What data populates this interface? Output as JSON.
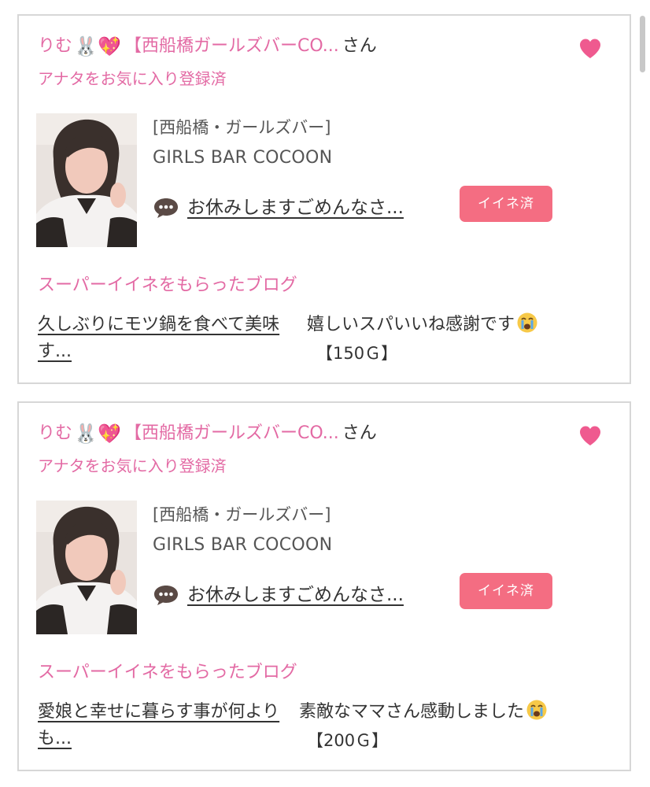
{
  "colors": {
    "accent_pink": "#e36aa4",
    "badge_pink": "#f46d82",
    "heart_pink": "#ef5a8f",
    "border_gray": "#d7d7d7"
  },
  "cards": [
    {
      "cast_name": "りむ",
      "emoji_1": "🐰",
      "emoji_2": "💖",
      "shop_short": "【西船橋ガールズバーCO...",
      "honorific": "さん",
      "favorite_status": "アナタをお気に入り登録済",
      "like_icon": "heart-icon",
      "shop_category": "[西船橋・ガールズバー]",
      "shop_name": "GIRLS BAR COCOON",
      "chat_icon": "speech-bubble-icon",
      "post_title": "お休みしますごめんなさ...",
      "iine_label": "イイネ済",
      "super_label": "スーパーイイネをもらったブログ",
      "blog_title": "久しぶりにモツ鍋を食べて美味す...",
      "comment": "嬉しいスパいいね感謝です",
      "comment_emoji": "😭",
      "points": "【150Ｇ】"
    },
    {
      "cast_name": "りむ",
      "emoji_1": "🐰",
      "emoji_2": "💖",
      "shop_short": "【西船橋ガールズバーCO...",
      "honorific": "さん",
      "favorite_status": "アナタをお気に入り登録済",
      "like_icon": "heart-icon",
      "shop_category": "[西船橋・ガールズバー]",
      "shop_name": "GIRLS BAR COCOON",
      "chat_icon": "speech-bubble-icon",
      "post_title": "お休みしますごめんなさ...",
      "iine_label": "イイネ済",
      "super_label": "スーパーイイネをもらったブログ",
      "blog_title": "愛娘と幸せに暮らす事が何よりも...",
      "comment": "素敵なママさん感動しました",
      "comment_emoji": "😭",
      "points": "【200Ｇ】"
    }
  ]
}
